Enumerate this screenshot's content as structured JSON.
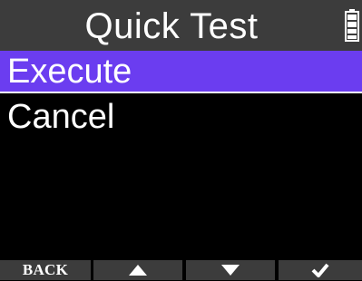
{
  "header": {
    "title": "Quick Test",
    "battery_icon": "battery-icon"
  },
  "menu": {
    "items": [
      {
        "label": "Execute",
        "selected": true
      },
      {
        "label": "Cancel",
        "selected": false
      }
    ]
  },
  "function_keys": [
    {
      "label": "BACK",
      "icon": null
    },
    {
      "label": "",
      "icon": "triangle-up-icon"
    },
    {
      "label": "",
      "icon": "triangle-down-icon"
    },
    {
      "label": "",
      "icon": "checkmark-icon"
    }
  ],
  "colors": {
    "background": "#000000",
    "bar": "#3c3c3c",
    "selection": "#6b3df0",
    "text": "#ffffff"
  }
}
